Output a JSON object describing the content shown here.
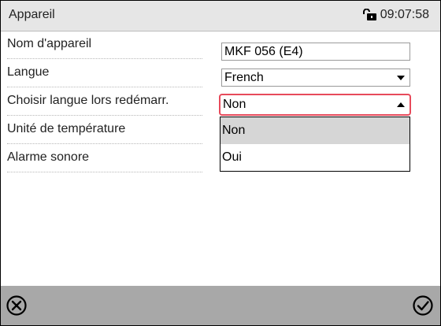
{
  "header": {
    "title": "Appareil",
    "time": "09:07:58",
    "lock_icon": "unlock-icon"
  },
  "settings": {
    "rows": [
      {
        "label": "Nom d'appareil",
        "value": "MKF 056 (E4)"
      },
      {
        "label": "Langue",
        "value": "French"
      },
      {
        "label": "Choisir langue lors redémarr.",
        "value": "Non"
      },
      {
        "label": "Unité de température"
      },
      {
        "label": "Alarme sonore"
      }
    ]
  },
  "dropdown": {
    "options": [
      "Non",
      "Oui"
    ],
    "selected": "Non"
  },
  "footer": {
    "cancel_icon": "cancel-circle-icon",
    "confirm_icon": "checkmark-circle-icon"
  },
  "colors": {
    "header_bg": "#e6e6e6",
    "footer_bg": "#a8a8a8",
    "active_border": "#e74a5b",
    "selected_option_bg": "#d6d6d6"
  }
}
